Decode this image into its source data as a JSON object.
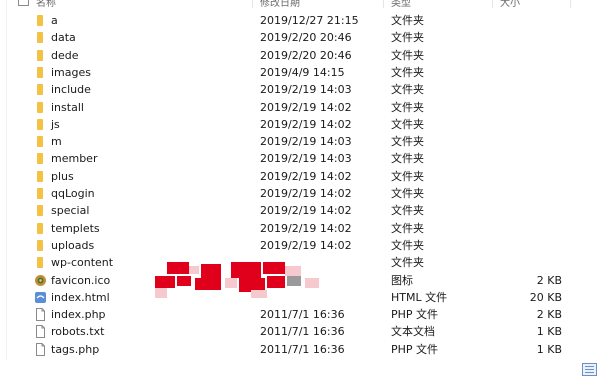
{
  "header": {
    "name": "名称",
    "modified": "修改日期",
    "type": "类型",
    "size": "大小"
  },
  "files": [
    {
      "name": "a",
      "modified": "2019/12/27 21:15",
      "type": "文件夹",
      "size": "",
      "icon": "folder-icon"
    },
    {
      "name": "data",
      "modified": "2019/2/20 20:46",
      "type": "文件夹",
      "size": "",
      "icon": "folder-icon"
    },
    {
      "name": "dede",
      "modified": "2019/2/20 20:46",
      "type": "文件夹",
      "size": "",
      "icon": "folder-icon"
    },
    {
      "name": "images",
      "modified": "2019/4/9 14:15",
      "type": "文件夹",
      "size": "",
      "icon": "folder-icon"
    },
    {
      "name": "include",
      "modified": "2019/2/19 14:03",
      "type": "文件夹",
      "size": "",
      "icon": "folder-icon"
    },
    {
      "name": "install",
      "modified": "2019/2/19 14:02",
      "type": "文件夹",
      "size": "",
      "icon": "folder-icon"
    },
    {
      "name": "js",
      "modified": "2019/2/19 14:02",
      "type": "文件夹",
      "size": "",
      "icon": "folder-icon"
    },
    {
      "name": "m",
      "modified": "2019/2/19 14:03",
      "type": "文件夹",
      "size": "",
      "icon": "folder-icon"
    },
    {
      "name": "member",
      "modified": "2019/2/19 14:03",
      "type": "文件夹",
      "size": "",
      "icon": "folder-icon"
    },
    {
      "name": "plus",
      "modified": "2019/2/19 14:02",
      "type": "文件夹",
      "size": "",
      "icon": "folder-icon"
    },
    {
      "name": "qqLogin",
      "modified": "2019/2/19 14:02",
      "type": "文件夹",
      "size": "",
      "icon": "folder-icon"
    },
    {
      "name": "special",
      "modified": "2019/2/19 14:02",
      "type": "文件夹",
      "size": "",
      "icon": "folder-icon"
    },
    {
      "name": "templets",
      "modified": "2019/2/19 14:02",
      "type": "文件夹",
      "size": "",
      "icon": "folder-icon"
    },
    {
      "name": "uploads",
      "modified": "2019/2/19 14:02",
      "type": "文件夹",
      "size": "",
      "icon": "folder-icon"
    },
    {
      "name": "wp-content",
      "modified": "",
      "type": "文件夹",
      "size": "",
      "icon": "folder-icon"
    },
    {
      "name": "favicon.ico",
      "modified": "",
      "type": "图标",
      "size": "2 KB",
      "icon": "ico-file-icon"
    },
    {
      "name": "index.html",
      "modified": "",
      "type": "HTML 文件",
      "size": "20 KB",
      "icon": "html-file-icon"
    },
    {
      "name": "index.php",
      "modified": "2011/7/1 16:36",
      "type": "PHP 文件",
      "size": "2 KB",
      "icon": "php-file-icon"
    },
    {
      "name": "robots.txt",
      "modified": "2011/7/1 16:36",
      "type": "文本文档",
      "size": "1 KB",
      "icon": "txt-file-icon"
    },
    {
      "name": "tags.php",
      "modified": "2011/7/1 16:36",
      "type": "PHP 文件",
      "size": "1 KB",
      "icon": "php-file-icon"
    }
  ],
  "colors": {
    "folder": "#f3c242",
    "redaction_red": "#e0001b",
    "redaction_pink": "#f6c9cf",
    "redaction_gray": "#9a9a9a"
  }
}
